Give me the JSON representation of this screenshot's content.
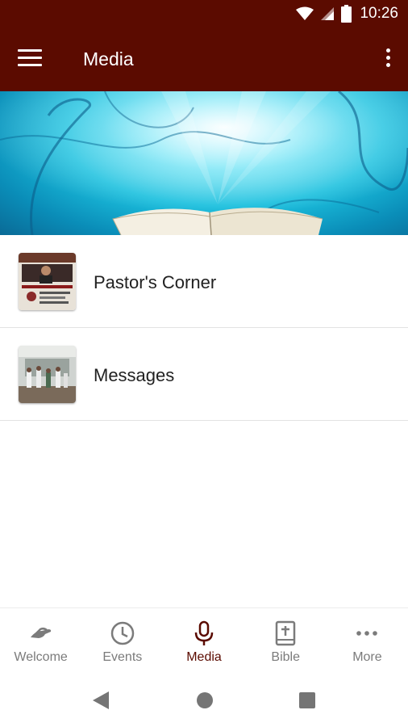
{
  "status_bar": {
    "time": "10:26",
    "icons": [
      "wifi-icon",
      "signal-icon",
      "battery-icon"
    ]
  },
  "app_bar": {
    "title": "Media",
    "menu_icon": "hamburger-menu-icon",
    "overflow_icon": "more-vert-icon"
  },
  "banner": {
    "description_icon": "open-bible-image"
  },
  "media_list": [
    {
      "label": "Pastor's Corner",
      "thumbnail": "pastor-thumbnail"
    },
    {
      "label": "Messages",
      "thumbnail": "messages-thumbnail"
    }
  ],
  "bottom_nav": {
    "items": [
      {
        "label": "Welcome",
        "icon": "handshake-icon",
        "active": false
      },
      {
        "label": "Events",
        "icon": "clock-icon",
        "active": false
      },
      {
        "label": "Media",
        "icon": "microphone-icon",
        "active": true
      },
      {
        "label": "Bible",
        "icon": "bible-icon",
        "active": false
      },
      {
        "label": "More",
        "icon": "more-horiz-icon",
        "active": false
      }
    ]
  },
  "system_nav": {
    "icons": [
      "back-icon",
      "home-icon",
      "recents-icon"
    ]
  },
  "colors": {
    "primary": "#5b0b00",
    "inactive": "#7b7b7b",
    "divider": "#e2e2e2"
  }
}
